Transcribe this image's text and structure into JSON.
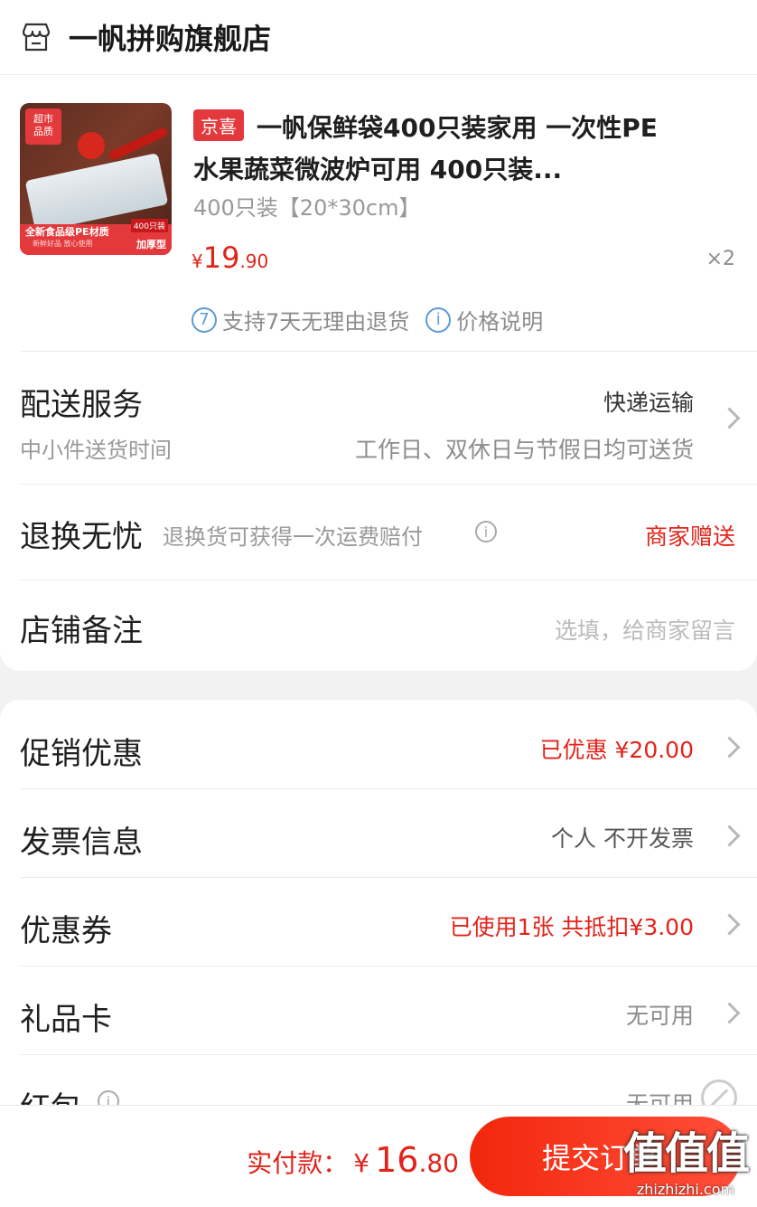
{
  "shop": {
    "name": "一帆拼购旗舰店"
  },
  "product": {
    "tag": "京喜",
    "title_line1": "一帆保鲜袋400只装家用 一次性PE",
    "title_line2": "水果蔬菜微波炉可用 400只装...",
    "spec": "400只装【20*30cm】",
    "price_currency": "¥",
    "price_int": "19",
    "price_dec": ".90",
    "quantity": "×2",
    "image_text": {
      "corner_badge": "超市\n品质",
      "banner": "全新食品级PE材质",
      "banner_sub": "新鲜好品 放心使用",
      "count_badge": "400只装",
      "thick": "加厚型"
    },
    "badges": [
      {
        "icon_text": "7",
        "label": "支持7天无理由退货"
      },
      {
        "icon_text": "i",
        "label": "价格说明"
      }
    ]
  },
  "delivery": {
    "label": "配送服务",
    "sub_label": "中小件送货时间",
    "method": "快递运输",
    "time": "工作日、双休日与节假日均可送货"
  },
  "return_insurance": {
    "label": "退换无忧",
    "desc": "退换货可获得一次运费赔付",
    "value": "商家赠送"
  },
  "shop_note": {
    "label": "店铺备注",
    "placeholder": "选填，给商家留言"
  },
  "rows": {
    "promo": {
      "label": "促销优惠",
      "value": "已优惠 ¥20.00"
    },
    "invoice": {
      "label": "发票信息",
      "value": "个人 不开发票"
    },
    "coupon": {
      "label": "优惠券",
      "value": "已使用1张 共抵扣¥3.00"
    },
    "gift_card": {
      "label": "礼品卡",
      "value": "无可用"
    },
    "red_packet": {
      "label": "红包",
      "value": "无可用"
    }
  },
  "bottom": {
    "pay_label": "实付款：",
    "currency": "¥",
    "int": "16",
    "dec": ".80",
    "submit_label": "提交订单"
  },
  "watermark": {
    "logo": "值值值",
    "url": "zhizhizhi.com"
  },
  "colors": {
    "accent": "#e2231a",
    "button": "#f2270c",
    "stripe_red": "#e4393c",
    "stripe_blue": "#5b9bd5"
  }
}
